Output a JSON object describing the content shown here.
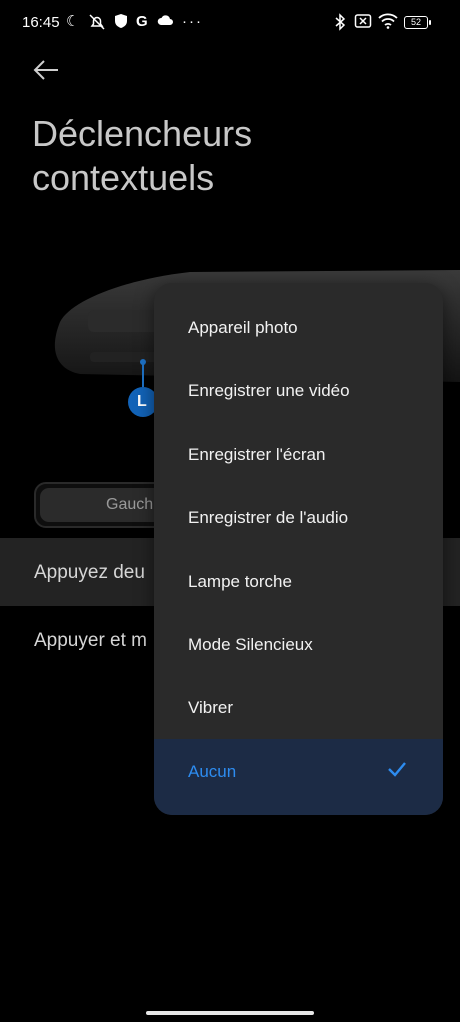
{
  "status_bar": {
    "time": "16:45",
    "battery": "52"
  },
  "page": {
    "title": "Déclencheurs contextuels"
  },
  "illustration": {
    "button_marker": "L"
  },
  "segment": {
    "selected_label": "Gauch"
  },
  "rows": [
    {
      "label": "Appuyez deu"
    },
    {
      "label": "Appuyer et m"
    }
  ],
  "menu": {
    "items": [
      {
        "label": "Appareil photo"
      },
      {
        "label": "Enregistrer une vidéo"
      },
      {
        "label": "Enregistrer l'écran"
      },
      {
        "label": "Enregistrer de l'audio"
      },
      {
        "label": "Lampe torche"
      },
      {
        "label": "Mode Silencieux"
      },
      {
        "label": "Vibrer"
      },
      {
        "label": "Aucun",
        "selected": true
      }
    ]
  },
  "colors": {
    "accent": "#2d8cf0",
    "menu_bg": "#2a2a2a",
    "selected_bg": "#1c2b45",
    "row_highlight": "#232323"
  }
}
